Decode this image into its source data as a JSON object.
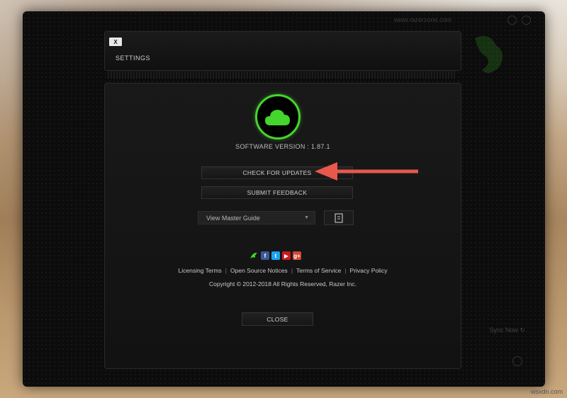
{
  "window": {
    "url_text": "www.razerzone.com"
  },
  "settings": {
    "close_x": "X",
    "title": "SETTINGS",
    "version": "SOFTWARE VERSION : 1.87.1",
    "check_updates": "CHECK FOR UPDATES",
    "submit_feedback": "SUBMIT FEEDBACK",
    "guide_select": "View Master Guide",
    "links": [
      "Licensing Terms",
      "Open Source Notices",
      "Terms of Service",
      "Privacy Policy"
    ],
    "copyright": "Copyright © 2012-2018 All Rights Reserved, Razer Inc.",
    "close": "CLOSE"
  },
  "social_icons": [
    "razer-icon",
    "facebook-icon",
    "twitter-icon",
    "youtube-icon",
    "google-plus-icon"
  ],
  "background_side_text": "Sync Now ↻",
  "watermark": "wsxdn.com",
  "colors": {
    "accent_green": "#44d62c",
    "arrow_red": "#e8584d"
  }
}
